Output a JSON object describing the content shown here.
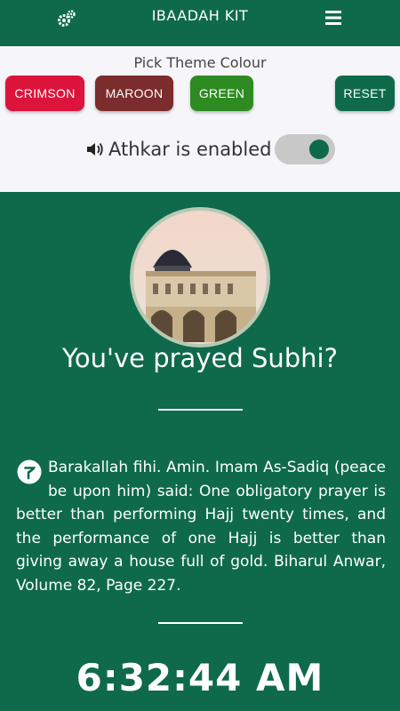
{
  "app": {
    "title": "IBAADAH KIT"
  },
  "header": {
    "settings_icon": "gears-icon",
    "menu_icon": "hamburger-menu-icon"
  },
  "theme": {
    "heading": "Pick Theme Colour",
    "buttons": [
      {
        "label": "CRIMSON",
        "color": "#dc143c"
      },
      {
        "label": "MAROON",
        "color": "#7b2c2c"
      },
      {
        "label": "GREEN",
        "color": "#2e8b22"
      },
      {
        "label": "RESET",
        "color": "#0e6a4a"
      }
    ]
  },
  "athkar": {
    "label": "Athkar is enabled",
    "enabled": true,
    "icon": "speaker-icon"
  },
  "prayer": {
    "question": "You've prayed Subhi?",
    "quote": "Barakallah fihi. Amin. Imam As-Sadiq (peace be upon him) said: One obligatory prayer is better than performing Hajj twenty times, and the performance of one Hajj is better than giving away a house full of gold. Biharul Anwar, Volume 82, Page 227."
  },
  "clock": {
    "time": "6:32:44 AM"
  },
  "colors": {
    "primary": "#0e6a4a",
    "panel": "#f6f6fa"
  }
}
